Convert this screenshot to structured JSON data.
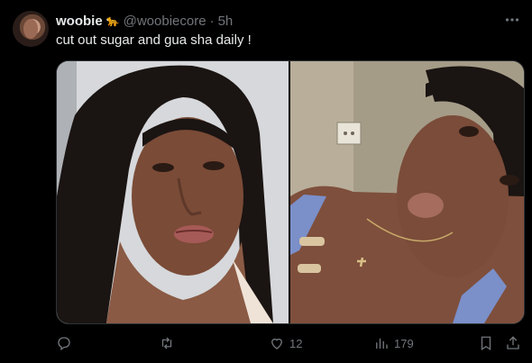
{
  "tweet": {
    "author_name": "woobie",
    "author_emoji": "🐆",
    "handle": "@woobiecore",
    "separator": "·",
    "time": "5h",
    "text": "cut out sugar and gua sha daily !"
  },
  "actions": {
    "reply_icon": "reply-icon",
    "retweet_icon": "retweet-icon",
    "like_count": "12",
    "views_count": "179",
    "bookmark_icon": "bookmark-icon",
    "share_icon": "share-icon"
  },
  "colors": {
    "background": "#000000",
    "text": "#e7e9ea",
    "secondary": "#71767b",
    "border": "#2f3336"
  }
}
